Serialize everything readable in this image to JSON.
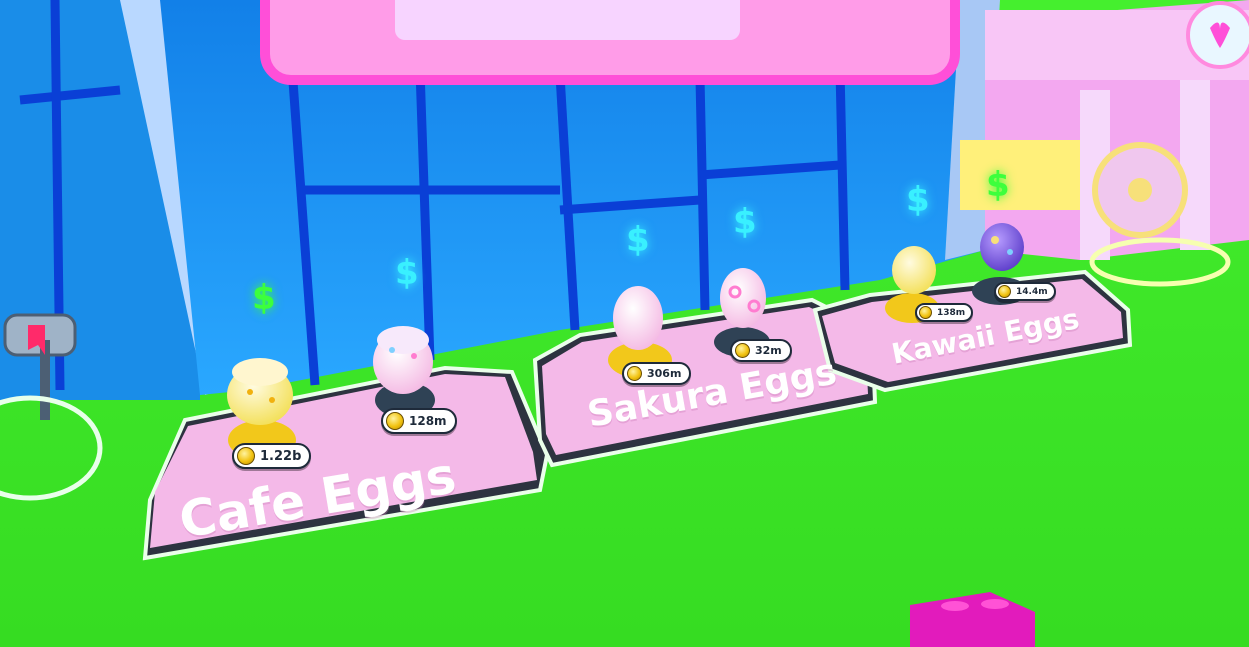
{
  "platforms": [
    {
      "label": "Cafe Eggs"
    },
    {
      "label": "Sakura Eggs"
    },
    {
      "label": "Kawaii Eggs"
    }
  ],
  "eggs": [
    {
      "price": "1.22b",
      "pedestal": "gold"
    },
    {
      "price": "128m",
      "pedestal": "gray"
    },
    {
      "price": "306m",
      "pedestal": "gold"
    },
    {
      "price": "32m",
      "pedestal": "gray"
    },
    {
      "price": "138m",
      "pedestal": "gold"
    },
    {
      "price": "14.4m",
      "pedestal": "gray"
    }
  ],
  "currency_symbol": "$",
  "colors": {
    "grass": "#3fe82a",
    "wall_blue": "#1e96f5",
    "platform_pink": "#f2b6e6",
    "neon_pink": "#ff4fd8",
    "dollar_green": "#3cff3c",
    "dollar_cyan": "#39f0ff",
    "gold": "#f7d629"
  },
  "icons": [
    "coin-icon",
    "dollar-sign-icon",
    "mailbox-icon",
    "vault-door-icon",
    "toy-block-icon"
  ]
}
